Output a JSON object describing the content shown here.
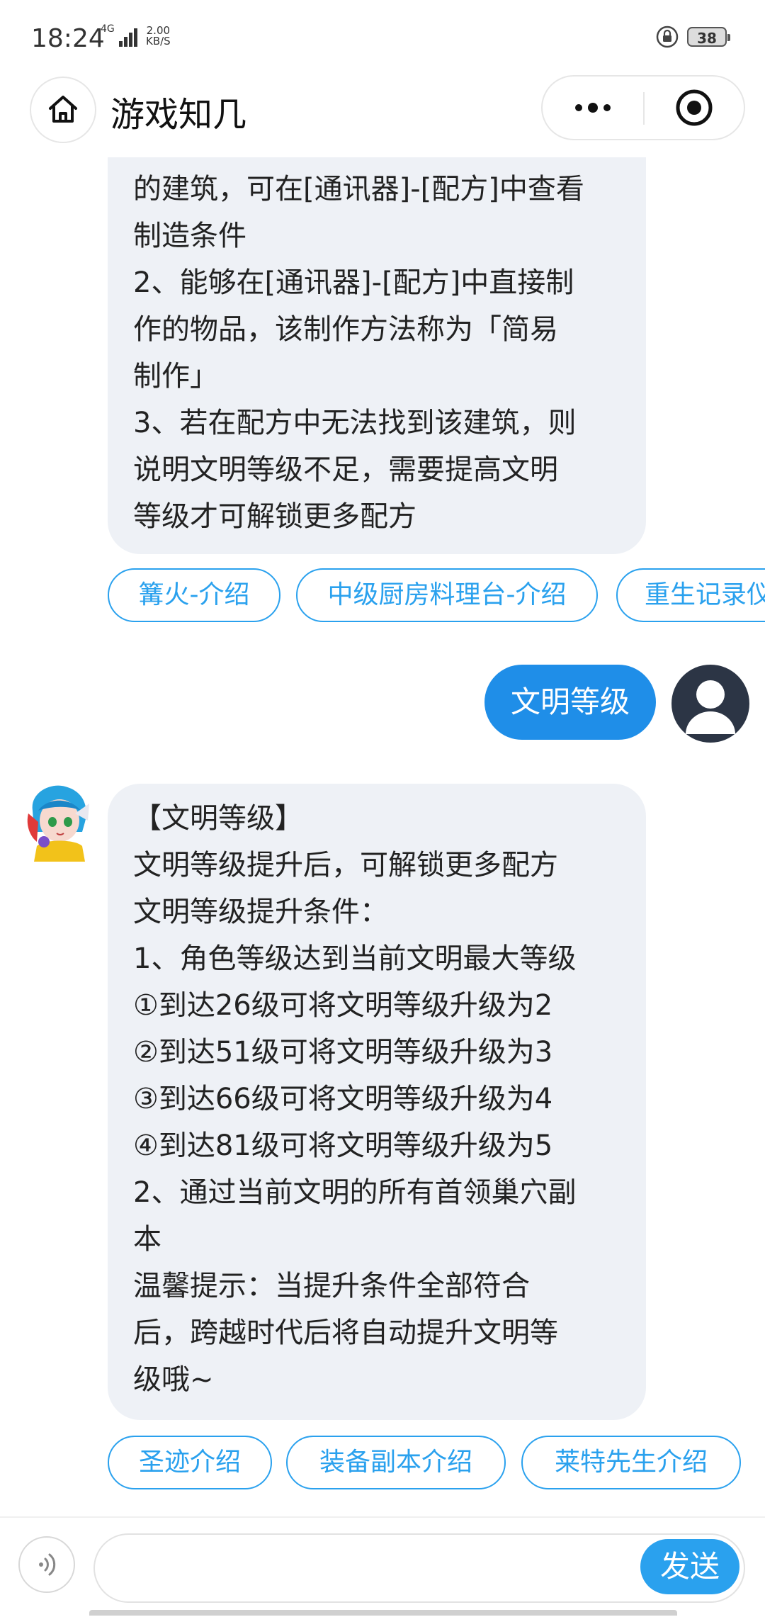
{
  "status_bar": {
    "time": "18:24",
    "network": "4G",
    "speed_value": "2.00",
    "speed_unit": "KB/S",
    "battery": "38"
  },
  "header": {
    "title": "游戏知几"
  },
  "messages": {
    "bot_prev_lines": [
      "的建筑，可在[通讯器]-[配方]中查看",
      "制造条件",
      "2、能够在[通讯器]-[配方]中直接制",
      "作的物品，该制作方法称为「简易",
      "制作」",
      "3、若在配方中无法找到该建筑，则",
      "说明文明等级不足，需要提高文明",
      "等级才可解锁更多配方"
    ],
    "chips_1": [
      "篝火-介绍",
      "中级厨房料理台-介绍",
      "重生记录仪"
    ],
    "user_text": "文明等级",
    "bot_reply_lines": [
      "【文明等级】",
      "文明等级提升后，可解锁更多配方",
      "文明等级提升条件：",
      "1、角色等级达到当前文明最大等级",
      "①到达26级可将文明等级升级为2",
      "②到达51级可将文明等级升级为3",
      "③到达66级可将文明等级升级为4",
      "④到达81级可将文明等级升级为5",
      "2、通过当前文明的所有首领巢穴副",
      "本",
      "温馨提示：当提升条件全部符合",
      "后，跨越时代后将自动提升文明等",
      "级哦~"
    ],
    "chips_2": [
      "圣迹介绍",
      "装备副本介绍",
      "莱特先生介绍"
    ]
  },
  "input": {
    "value": "",
    "placeholder": "",
    "send_label": "发送"
  },
  "icons": {
    "home": "home-icon",
    "more": "more-dots-icon",
    "close": "close-target-icon",
    "voice": "voice-icon",
    "user_avatar": "user-avatar-icon",
    "lock": "lock-icon"
  },
  "colors": {
    "accent": "#2aa1ee",
    "user_bubble": "#1f8ee8",
    "bot_bubble": "#eef1f6"
  }
}
